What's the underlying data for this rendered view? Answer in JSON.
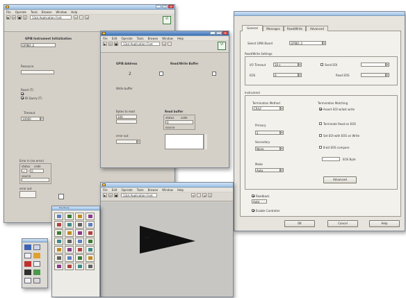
{
  "window_a": {
    "menu": [
      "File",
      "Operate",
      "Tools",
      "Browse",
      "Window",
      "Help"
    ],
    "toolbar_label": "13pt Application Font",
    "heading": "GPIB Instrument Initialization",
    "address_field": "GPIB0::2",
    "resource_label": "Resource",
    "reset_label": "Reset (T)",
    "id_query_label": "ID Query (T)",
    "error_in_label": "Error in (no error)",
    "status_label": "status",
    "code_label": "code",
    "source_label": "source",
    "status_value": "✓",
    "code_value": "0",
    "error_out_label": "error out",
    "timeout_label": "Timeout",
    "timeout_value": "10000"
  },
  "window_b": {
    "menu": [
      "File",
      "Edit",
      "Operate",
      "Tools",
      "Browse",
      "Window",
      "Help"
    ],
    "toolbar_label": "13pt Application Font",
    "col1_heading": "GPIB Address",
    "col2_heading": "Read/Write Buffer",
    "address_value": "2",
    "write_buffer_label": "Write buffer",
    "bytes_read_label": "Bytes to read",
    "bytes_read_value": "100",
    "read_label": "Read buffer",
    "status_label": "status",
    "code_label": "code",
    "source_label": "source",
    "code_value": "0",
    "error_label": "error out"
  },
  "dialog": {
    "tabs": [
      "General",
      "Messages",
      "Read/Write",
      "Advanced"
    ],
    "interface_label": "Select GPIB Board",
    "interface_value": "GPIB0::2",
    "read_write_settings_label": "Read/Write Settings",
    "timeout_label": "I/O Timeout",
    "timeout_value": "10 s",
    "eos_label": "EOS",
    "eos_value": "0",
    "send_eoi_label": "Send EOI",
    "read_eos_label": "Read EOS",
    "read_eos_value": "",
    "instrument_label": "Instrument",
    "term_label": "Termination Method",
    "term_value": "CR/LF",
    "primary_label": "Primary",
    "primary_value": "2",
    "secondary_label": "Secondary",
    "secondary_value": "None",
    "mode_label": "Mode",
    "mode_value": "Auto",
    "term_group_label": "Termination Matching",
    "options": [
      {
        "label": "Assert EOI w/last write",
        "checked": true
      },
      {
        "label": "Terminate Read on EOS",
        "checked": false
      },
      {
        "label": "Set EOI with EOS on Write",
        "checked": false
      },
      {
        "label": "8-bit EOS compare",
        "checked": false
      }
    ],
    "eos_byte_value": "",
    "eos_byte_label": "EOS Byte",
    "bottom_check1_label": "Readback",
    "bottom_check1_value": "Auto",
    "bottom_check2_label": "Enable Controller",
    "advanced_button": "Advanced",
    "ok_button": "OK",
    "cancel_button": "Cancel",
    "help_button": "Help"
  },
  "window_c": {
    "menu": [
      "File",
      "Edit",
      "Operate",
      "Tools",
      "Browse",
      "Window",
      "Help"
    ],
    "toolbar_label": "13pt Application Font",
    "arrow_label": "Run"
  },
  "palette": {
    "title": "Functions"
  }
}
